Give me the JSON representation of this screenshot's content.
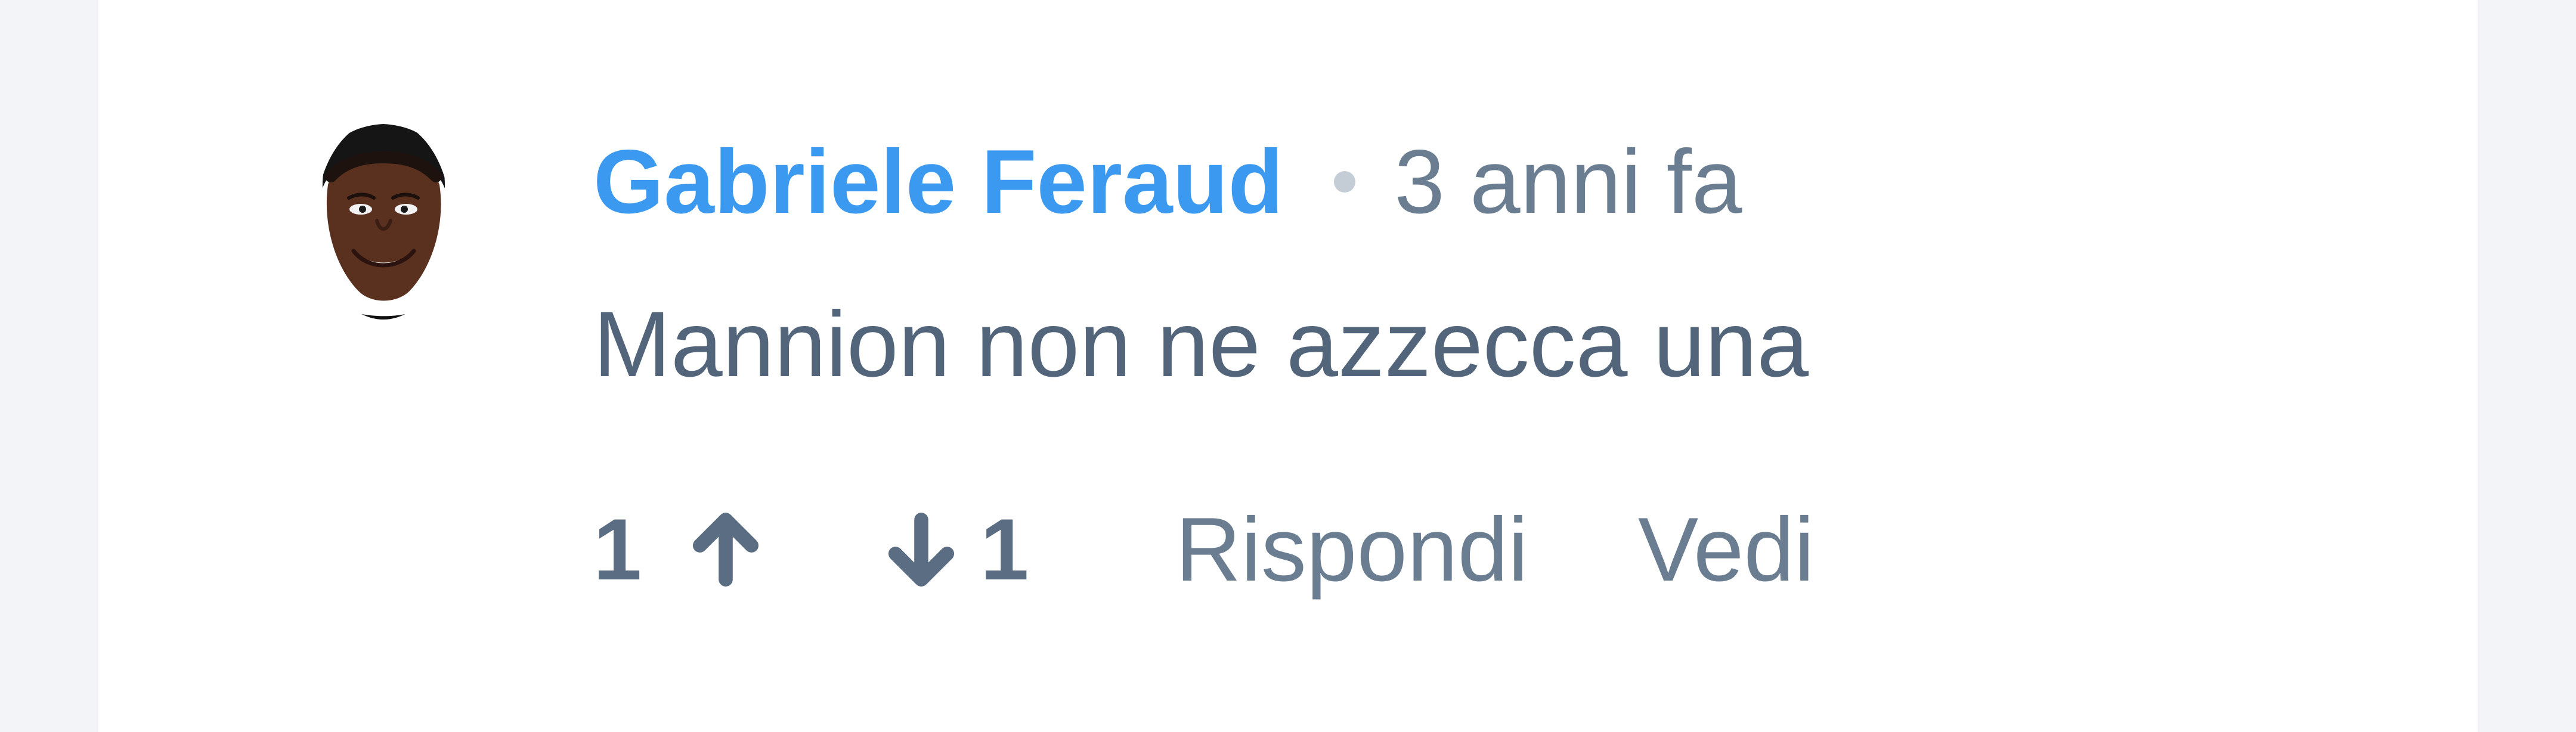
{
  "comment": {
    "author": "Gabriele Feraud",
    "timestamp": "3 anni fa",
    "text": "Mannion non ne azzecca una",
    "upvotes": "1",
    "downvotes": "1",
    "actions": {
      "reply": "Rispondi",
      "view": "Vedi"
    }
  },
  "icons": {
    "avatar": "avatar",
    "upvote": "arrow-up-icon",
    "downvote": "arrow-down-icon",
    "separator": "dot-separator"
  },
  "colors": {
    "page_background": "#f2f4f8",
    "card_background": "#ffffff",
    "author_link": "#3b99f0",
    "secondary_text": "#6a7d91",
    "comment_text": "#52657a",
    "vote_text": "#5a6d82",
    "separator_dot": "#c4ccd6"
  }
}
